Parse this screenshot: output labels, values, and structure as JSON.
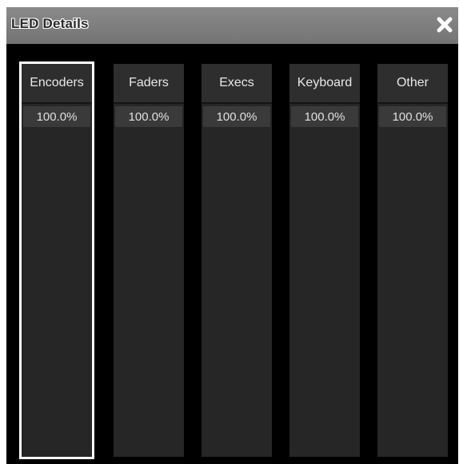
{
  "window": {
    "title": "LED Details",
    "close_icon": "close-icon"
  },
  "columns": [
    {
      "label": "Encoders",
      "value": "100.0%",
      "selected": true
    },
    {
      "label": "Faders",
      "value": "100.0%",
      "selected": false
    },
    {
      "label": "Execs",
      "value": "100.0%",
      "selected": false
    },
    {
      "label": "Keyboard",
      "value": "100.0%",
      "selected": false
    },
    {
      "label": "Other",
      "value": "100.0%",
      "selected": false
    }
  ],
  "colors": {
    "titlebar": "#7f7f7f",
    "background": "#000000",
    "column": "#262626",
    "selection": "#ffffff"
  }
}
